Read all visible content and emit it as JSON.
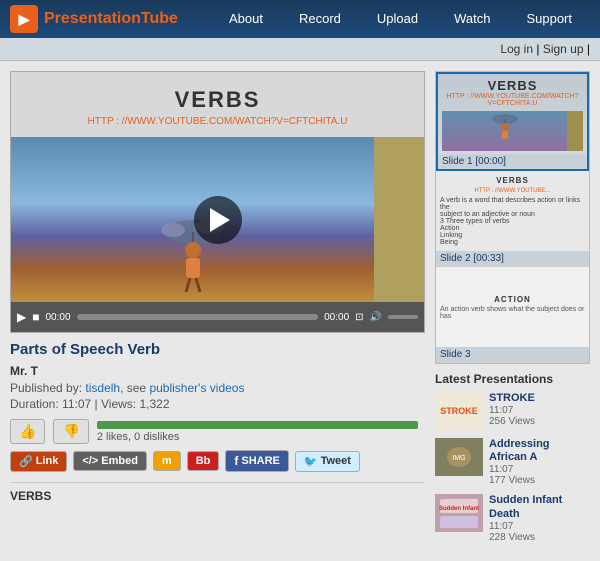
{
  "header": {
    "logo_text1": "Presentation",
    "logo_text2": "Tube",
    "nav_items": [
      "About",
      "Record",
      "Upload",
      "Watch",
      "Support"
    ]
  },
  "auth": {
    "login": "Log in",
    "separator": "|",
    "signup": "Sign up",
    "separator2": "|"
  },
  "video": {
    "title": "VERBS",
    "url": "HTTP : //WWW.YOUTUBE.COM/WATCH?V=CFTCHITA.U",
    "time_current": "00:00",
    "time_total": "00:00"
  },
  "presentation": {
    "title": "Parts of Speech Verb",
    "author": "Mr. T",
    "published_by_label": "Published by:",
    "publisher": "tisdelh",
    "see_label": "see",
    "publishers_videos": "publisher's videos",
    "duration_label": "Duration:",
    "duration": "11:07",
    "views_label": "Views:",
    "views": "1,322",
    "likes": 2,
    "dislikes": 0,
    "like_text": "2 likes, 0 dislikes"
  },
  "share_buttons": [
    {
      "id": "link",
      "label": "Link"
    },
    {
      "id": "embed",
      "label": "Embed"
    },
    {
      "id": "moodle",
      "label": "m"
    },
    {
      "id": "bb",
      "label": "Bb"
    },
    {
      "id": "facebook",
      "label": "SHARE"
    },
    {
      "id": "twitter",
      "label": "Tweet"
    }
  ],
  "transcript": {
    "label": "VERBS"
  },
  "slides": [
    {
      "label": "Slide 1 [00:00]",
      "title": "VERBS",
      "url": "HTTP : //WWW.YOUTUBE.COM/WATCH?V=CFTCHITA.U"
    },
    {
      "label": "Slide 2 [00:33]",
      "title": "VERBS",
      "content": "A verb is a word that describes action or links the subject to an adjective or noun\n3 Three types of verbs\nAction\nLinking\nBeing"
    },
    {
      "label": "Slide 3",
      "title": "ACTION",
      "content": "An action verb shows what the subject does or has"
    }
  ],
  "latest": {
    "title": "Latest Presentations",
    "items": [
      {
        "title": "STROKE",
        "time": "11:07",
        "views": "256 Views"
      },
      {
        "title": "Addressing African A",
        "time": "11:07",
        "views": "177 Views"
      },
      {
        "title": "Sudden Infant Death",
        "time": "11:07",
        "views": "228 Views"
      }
    ]
  }
}
